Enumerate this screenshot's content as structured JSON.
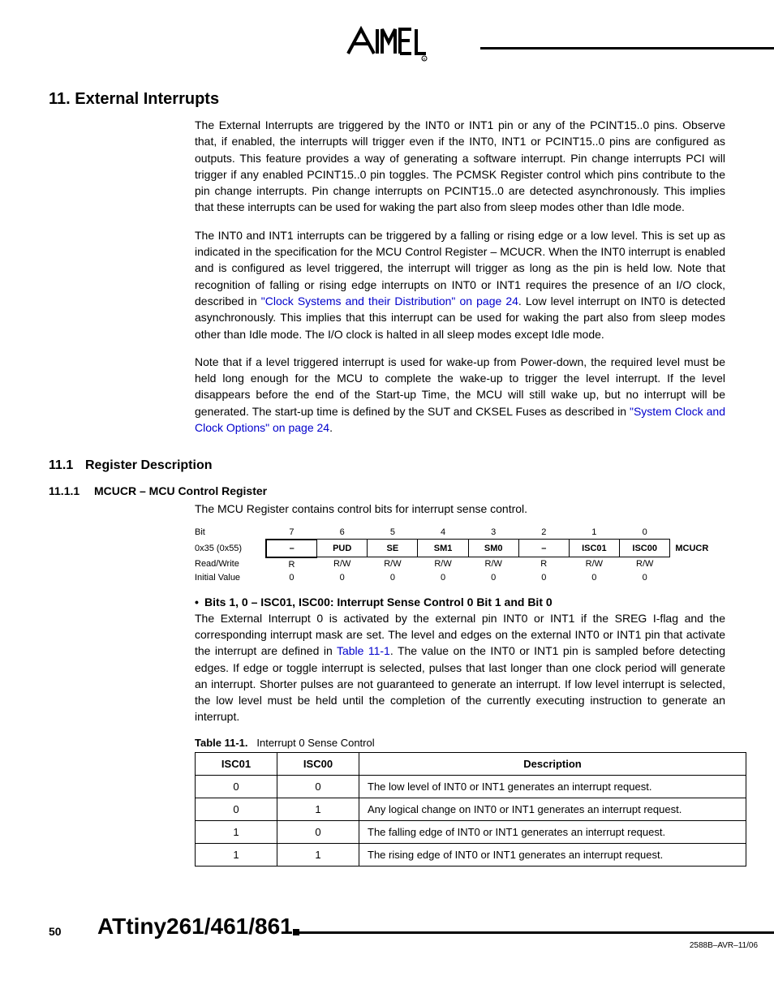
{
  "logo_brand": "AIMEL",
  "section": {
    "num": "11.",
    "title": "External Interrupts"
  },
  "para1": "The External Interrupts are triggered by the INT0 or INT1 pin or any of the PCINT15..0 pins. Observe that, if enabled, the interrupts will trigger even if the INT0, INT1 or PCINT15..0 pins are configured as outputs. This feature provides a way of generating a software interrupt. Pin change interrupts PCI will trigger if any enabled PCINT15..0 pin toggles. The PCMSK Register control which pins contribute to the pin change interrupts. Pin change interrupts on PCINT15..0 are detected asynchronously. This implies that these interrupts can be used for waking the part also from sleep modes other than Idle mode.",
  "para2_a": "The INT0 and INT1 interrupts can be triggered by a falling or rising edge or a low level. This is set up as indicated in the specification for the MCU Control Register – MCUCR. When the INT0 interrupt is enabled and is configured as level triggered, the interrupt will trigger as long as the pin is held low. Note that recognition of falling or rising edge interrupts on INT0 or INT1 requires the presence of an I/O clock, described in ",
  "para2_link": "\"Clock Systems and their Distribution\" on page 24",
  "para2_b": ". Low level interrupt on INT0 is detected asynchronously. This implies that this interrupt can be used for waking the part also from sleep modes other than Idle mode. The I/O clock is halted in all sleep modes except Idle mode.",
  "para3_a": "Note that if a level triggered interrupt is used for wake-up from Power-down, the required level must be held long enough for the MCU to complete the wake-up to trigger the level interrupt. If the level disappears before the end of the Start-up Time, the MCU will still wake up, but no interrupt will be generated. The start-up time is defined by the SUT and CKSEL Fuses as described in ",
  "para3_link": "\"System Clock and Clock Options\" on page 24",
  "para3_b": ".",
  "subsection": {
    "num": "11.1",
    "title": "Register Description"
  },
  "subsub": {
    "num": "11.1.1",
    "title": "MCUCR – MCU Control Register"
  },
  "subsub_intro": "The MCU Register contains control bits for interrupt sense control.",
  "register": {
    "bit_label": "Bit",
    "bits": [
      "7",
      "6",
      "5",
      "4",
      "3",
      "2",
      "1",
      "0"
    ],
    "addr_label": "0x35 (0x55)",
    "cells": [
      "–",
      "PUD",
      "SE",
      "SM1",
      "SM0",
      "–",
      "ISC01",
      "ISC00"
    ],
    "side_name": "MCUCR",
    "rw_label": "Read/Write",
    "rw": [
      "R",
      "R/W",
      "R/W",
      "R/W",
      "R/W",
      "R",
      "R/W",
      "R/W"
    ],
    "iv_label": "Initial Value",
    "iv": [
      "0",
      "0",
      "0",
      "0",
      "0",
      "0",
      "0",
      "0"
    ]
  },
  "bits_heading": "Bits 1, 0 – ISC01, ISC00: Interrupt Sense Control 0 Bit 1 and Bit 0",
  "bits_para_a": "The External Interrupt 0 is activated by the external pin INT0 or INT1 if the SREG I-flag and the corresponding interrupt mask are set. The level and edges on the external INT0 or INT1 pin that activate the interrupt are defined in ",
  "bits_link": "Table 11-1",
  "bits_para_b": ". The value on the INT0 or INT1 pin is sampled before detecting edges. If edge or toggle interrupt is selected, pulses that last longer than one clock period will generate an interrupt. Shorter pulses are not guaranteed to generate an interrupt. If low level interrupt is selected, the low level must be held until the completion of the currently executing instruction to generate an interrupt.",
  "table_caption": {
    "label": "Table 11-1.",
    "title": "Interrupt 0 Sense Control"
  },
  "table": {
    "headers": [
      "ISC01",
      "ISC00",
      "Description"
    ],
    "rows": [
      [
        "0",
        "0",
        "The low level of INT0 or INT1 generates an interrupt request."
      ],
      [
        "0",
        "1",
        "Any logical change on INT0 or INT1 generates an interrupt request."
      ],
      [
        "1",
        "0",
        "The falling edge of INT0 or INT1 generates an interrupt request."
      ],
      [
        "1",
        "1",
        "The rising edge of INT0 or INT1 generates an interrupt request."
      ]
    ]
  },
  "footer": {
    "page": "50",
    "product": "ATtiny261/461/861",
    "docid": "2588B–AVR–11/06"
  },
  "chart_data": {
    "type": "table",
    "title": "Interrupt 0 Sense Control",
    "columns": [
      "ISC01",
      "ISC00",
      "Description"
    ],
    "rows": [
      [
        0,
        0,
        "The low level of INT0 or INT1 generates an interrupt request."
      ],
      [
        0,
        1,
        "Any logical change on INT0 or INT1 generates an interrupt request."
      ],
      [
        1,
        0,
        "The falling edge of INT0 or INT1 generates an interrupt request."
      ],
      [
        1,
        1,
        "The rising edge of INT0 or INT1 generates an interrupt request."
      ]
    ]
  }
}
